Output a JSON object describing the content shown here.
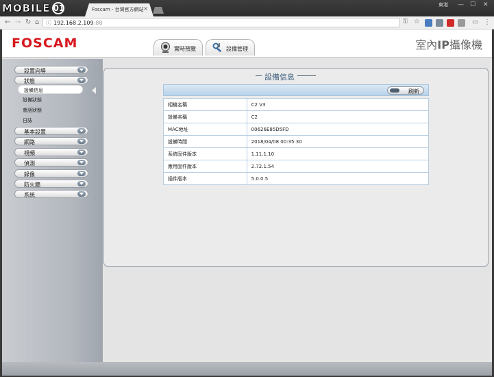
{
  "browser": {
    "site_logo_text": "MOBILE",
    "site_logo_glyph": "01",
    "tab_title": "Foscam - 台灣官方網站",
    "tab_close": "×",
    "user_label": "東湛",
    "win_min": "—",
    "win_max": "☐",
    "win_close": "✕",
    "url_host": "192.168.2.109",
    "url_port": ":88",
    "extensions": [
      {
        "name": "extension-a",
        "color": "#4a7cc0"
      },
      {
        "name": "extension-b",
        "color": "#7a8a9a"
      },
      {
        "name": "opera-extension",
        "color": "#d12a2a"
      },
      {
        "name": "extension-c",
        "color": "#9a9a9a"
      }
    ]
  },
  "header": {
    "brand": "FOSCAM",
    "product_prefix": "室內",
    "product_bold": "IP",
    "product_suffix": "攝像機"
  },
  "nav": {
    "live_view": "實時預覽",
    "device_mgmt": "設備管理"
  },
  "sidebar": {
    "items": [
      {
        "label": "設置向導"
      },
      {
        "label": "狀態"
      },
      {
        "label": "基本設置"
      },
      {
        "label": "網路"
      },
      {
        "label": "視頻"
      },
      {
        "label": "偵測"
      },
      {
        "label": "錄像"
      },
      {
        "label": "防火牆"
      },
      {
        "label": "系統"
      }
    ],
    "sub": {
      "active": "設備信息",
      "items": [
        "設備狀態",
        "會話狀態",
        "日誌"
      ]
    }
  },
  "main": {
    "title": "設備信息",
    "refresh": "刷新",
    "rows": [
      {
        "key": "相機名稱",
        "value": "C2 V3"
      },
      {
        "key": "設備名稱",
        "value": "C2"
      },
      {
        "key": "MAC地址",
        "value": "00626E85D5FD"
      },
      {
        "key": "設備時間",
        "value": "2018/04/08 00:35:30"
      },
      {
        "key": "系統固件版本",
        "value": "1.11.1.10"
      },
      {
        "key": "應用固件版本",
        "value": "2.72.1.54"
      },
      {
        "key": "插件版本",
        "value": "5.0.0.5"
      }
    ]
  }
}
